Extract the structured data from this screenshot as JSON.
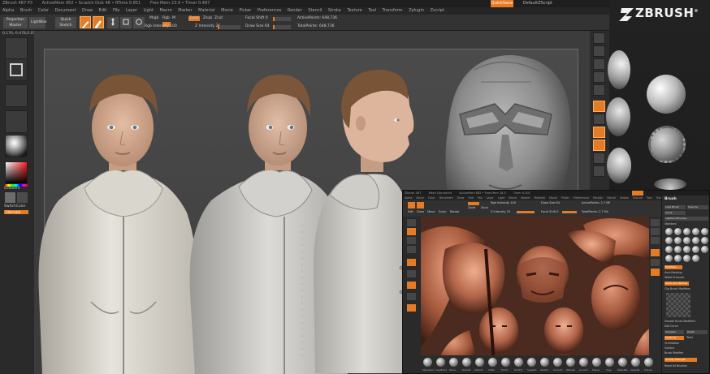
{
  "main": {
    "titlebar": [
      "ZBrush 4R7 P3",
      "ActiveMem 952 • Scratch Disk 48 • RTime 0.851",
      "Free Mem 23.9 • Timer 0.487"
    ],
    "quicksave": "QuickSave",
    "layout_label": "DefaultZScript",
    "menu": [
      "Alpha",
      "Brush",
      "Color",
      "Document",
      "Draw",
      "Edit",
      "File",
      "Layer",
      "Light",
      "Macro",
      "Marker",
      "Material",
      "Movie",
      "Picker",
      "Preferences",
      "Render",
      "Stencil",
      "Stroke",
      "Texture",
      "Tool",
      "Transform",
      "Zplugin",
      "Zscript"
    ],
    "toolbar": {
      "projection_master": "Projection Master",
      "lightbox": "LightBox",
      "quick_sketch": "Quick Sketch",
      "edit": "Edit",
      "draw": "Draw",
      "move": "Move",
      "scale": "Scale",
      "rotate": "Rotate",
      "mrgb": "Mrgb",
      "rgb": "Rgb",
      "m": "M",
      "zadd": "Zadd",
      "zsub": "Zsub",
      "zcut": "Zcut",
      "rgb_intensity": "Rgb Intensity 100",
      "z_intensity": "Z Intensity 25",
      "focal_shift": "Focal Shift 0",
      "draw_size": "Draw Size 64",
      "active_points": "ActivePoints: 648,736",
      "total_points": "TotalPoints: 648,736"
    },
    "coords": "0.176,-0.478,0.056",
    "left_shelf": {
      "gradient": "Gradient",
      "switch_color": "SwitchColor",
      "alternate": "Alternate"
    },
    "colors": {
      "accent": "#e57b24",
      "main_color": "#ff1e1e",
      "secondary_color": "#5a5a5a"
    }
  },
  "brand": {
    "name": "ZBRUSH",
    "mark": "®"
  },
  "sub": {
    "titlebar": [
      "ZBrush 4R7",
      "Mesh Document",
      "ActiveMem 882 • Free Mem 28.5",
      "Timer 0.001"
    ],
    "menu": [
      "Alpha",
      "Brush",
      "Color",
      "Document",
      "Draw",
      "Edit",
      "File",
      "Layer",
      "Light",
      "Macro",
      "Marker",
      "Material",
      "Movie",
      "Picker",
      "Preferences",
      "Render",
      "Stencil",
      "Stroke",
      "Texture",
      "Tool",
      "Transform",
      "Zplugin",
      "Zscript"
    ],
    "toolbar": {
      "edit": "Edit",
      "draw": "Draw",
      "move": "Move",
      "scale": "Scale",
      "rotate": "Rotate",
      "zadd": "Zadd",
      "zsub": "Zsub",
      "rgb_intensity": "Rgb Intensity 100",
      "z_intensity": "Z Intensity 25",
      "draw_size": "Draw Size 64",
      "focal_shift": "Focal Shift 0",
      "active_points": "ActivePoints: 2.7 Mil",
      "total_points": "TotalPoints: 2.7 Mil"
    },
    "brushes": [
      "Standard",
      "ClayBuild",
      "Move",
      "DamSt",
      "hPolish",
      "Inflat",
      "Pinch",
      "TrimDy",
      "SnakeH",
      "Slash3",
      "Smooth",
      "ZModel",
      "CurveT",
      "Planar",
      "Clay",
      "MaskPen",
      "SelectR",
      "Transp"
    ],
    "palette": {
      "title": "Brush",
      "load_brush": "Load Brush",
      "save_as": "Save As",
      "clone": "Clone",
      "lightbox_brushes": "Lightbox›Brushes",
      "standard": "Standard",
      "sections": [
        "Modifiers",
        "Auto Masking",
        "Tablet Pressure",
        "Alpha and Texture",
        "Clip Brush Modifiers",
        "Smooth Brush Modifiers",
        "Edit Curve",
        "Samples",
        "Depth",
        "Elasticity",
        "Twist",
        "Orientation",
        "Surface",
        "Brush Modifier",
        "Gravity Strength",
        "Reset All Brushes"
      ]
    }
  }
}
